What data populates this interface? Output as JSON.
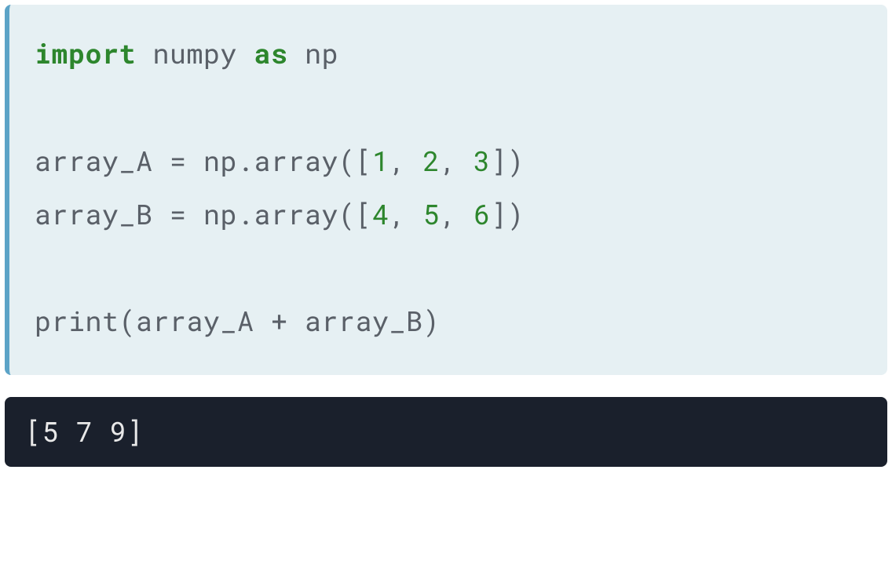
{
  "code": {
    "line1": {
      "kw_import": "import",
      "module": " numpy ",
      "kw_as": "as",
      "alias": " np"
    },
    "line3": {
      "prefix": "array_A = np.array([",
      "n1": "1",
      "c1": ", ",
      "n2": "2",
      "c2": ", ",
      "n3": "3",
      "suffix": "])"
    },
    "line4": {
      "prefix": "array_B = np.array([",
      "n1": "4",
      "c1": ", ",
      "n2": "5",
      "c2": ", ",
      "n3": "6",
      "suffix": "])"
    },
    "line6": "print(array_A + array_B)"
  },
  "output": {
    "line1": "[5 7 9]"
  }
}
